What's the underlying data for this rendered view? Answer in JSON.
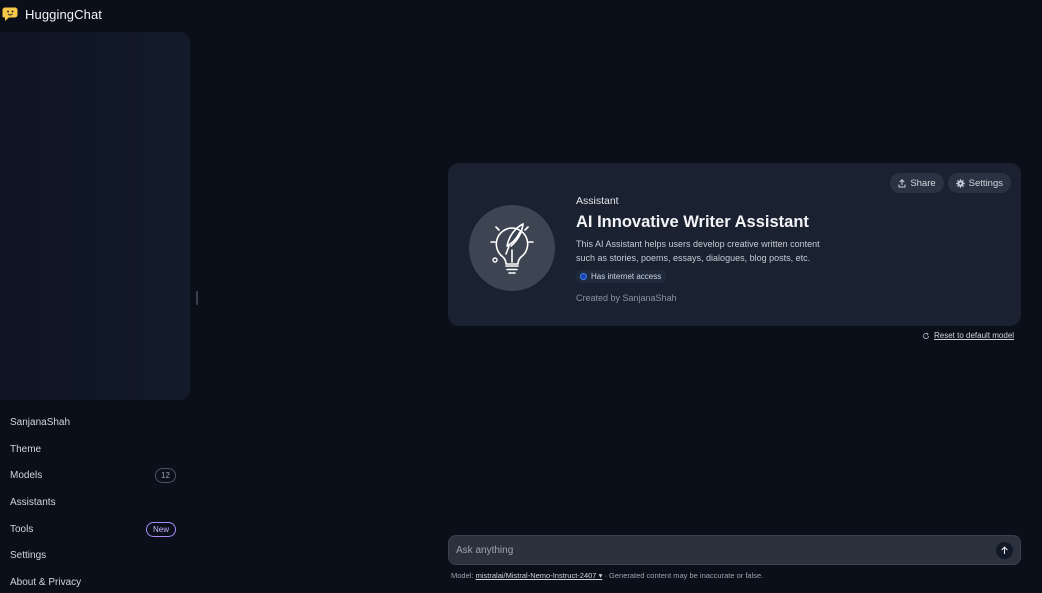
{
  "app": {
    "name": "HuggingChat"
  },
  "sidebar": {
    "items": [
      {
        "label": "SanjanaShah",
        "badge": ""
      },
      {
        "label": "Theme",
        "badge": ""
      },
      {
        "label": "Models",
        "badge": "12"
      },
      {
        "label": "Assistants",
        "badge": ""
      },
      {
        "label": "Tools",
        "badge": "New"
      },
      {
        "label": "Settings",
        "badge": ""
      },
      {
        "label": "About & Privacy",
        "badge": ""
      }
    ]
  },
  "assistant": {
    "label": "Assistant",
    "title": "AI Innovative Writer Assistant",
    "description": "This AI Assistant helps users develop creative written content such as stories, poems, essays, dialogues, blog posts, etc.",
    "internet_tag": "Has internet access",
    "created_by": "Created by SanjanaShah",
    "share_label": "Share",
    "settings_label": "Settings",
    "avatar_icon": "lightbulb-quill-icon"
  },
  "reset_link": "Reset to default model",
  "input": {
    "placeholder": "Ask anything",
    "value": ""
  },
  "footer": {
    "model_prefix": "Model:",
    "model_name": "mistralai/Mistral-Nemo-Instruct-2407",
    "disclaimer": "· Generated content may be inaccurate or false."
  },
  "colors": {
    "background": "#0b0f1a",
    "card": "#1a2130",
    "new_badge": "#a78bfa"
  }
}
